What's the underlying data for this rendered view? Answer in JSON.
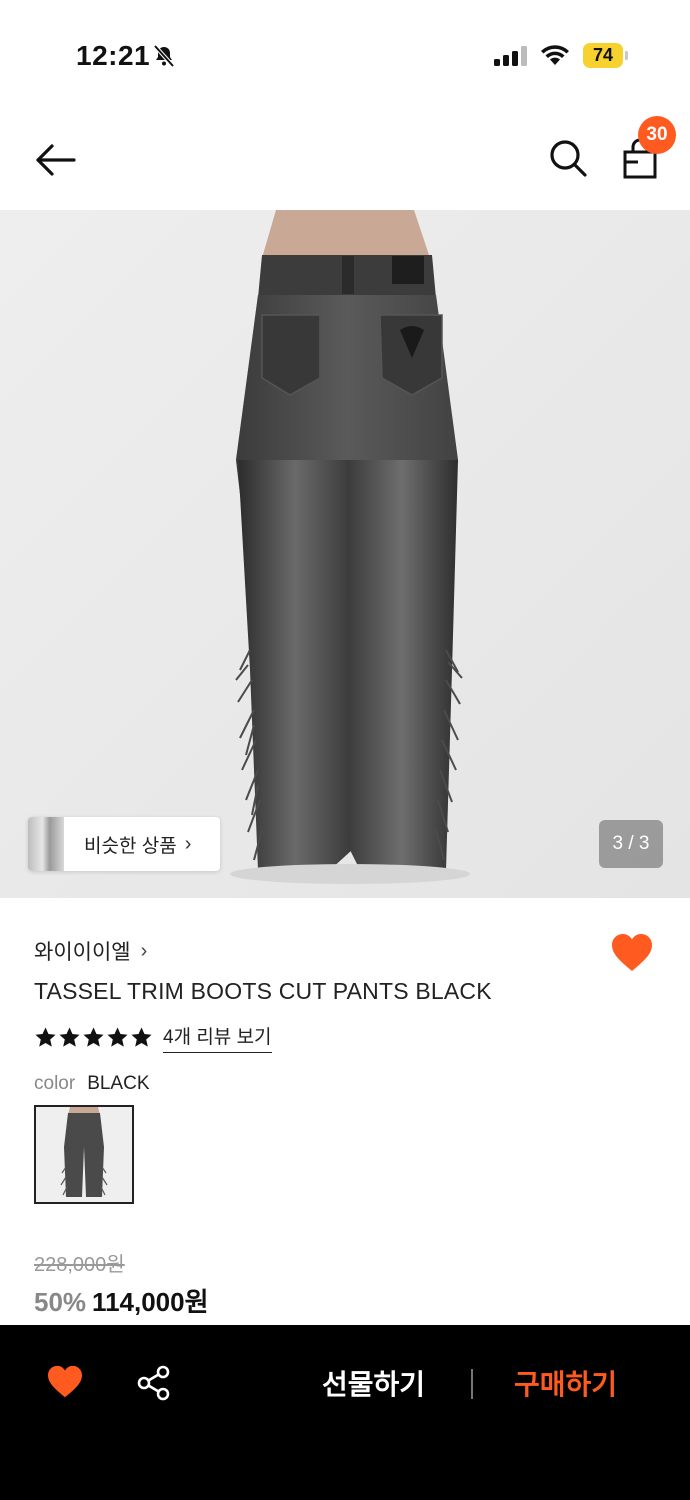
{
  "status_bar": {
    "time": "12:21",
    "battery": "74",
    "battery_color": "#f7d22e"
  },
  "header": {
    "back_icon": "back-arrow-icon",
    "search_icon": "search-icon",
    "cart_icon": "shopping-bag-icon",
    "cart_count": "30",
    "badge_color": "#ff5a1f"
  },
  "gallery": {
    "similar_products_label": "비슷한 상품",
    "page_indicator": "3 / 3"
  },
  "product": {
    "brand": "와이이이엘",
    "name": "TASSEL TRIM BOOTS CUT PANTS BLACK",
    "rating_stars": 5,
    "review_link": "4개 리뷰 보기",
    "color_label": "color",
    "color_value": "BLACK",
    "original_price": "228,000원",
    "discount": "50%",
    "price": "114,000원",
    "wishlisted": true
  },
  "bottom_bar": {
    "gift_label": "선물하기",
    "buy_label": "구매하기",
    "accent_color": "#ff5a1f"
  }
}
